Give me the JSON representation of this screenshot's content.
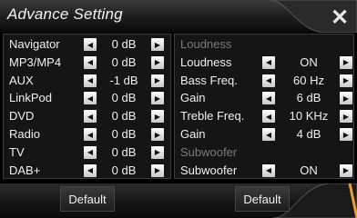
{
  "header": {
    "title": "Advance Setting",
    "close_icon": "close-icon"
  },
  "left_rows": [
    {
      "label": "Navigator",
      "value": "0 dB"
    },
    {
      "label": "MP3/MP4",
      "value": "0 dB"
    },
    {
      "label": "AUX",
      "value": "-1 dB"
    },
    {
      "label": "LinkPod",
      "value": "0 dB"
    },
    {
      "label": "DVD",
      "value": "0 dB"
    },
    {
      "label": "Radio",
      "value": "0 dB"
    },
    {
      "label": "TV",
      "value": "0 dB"
    },
    {
      "label": "DAB+",
      "value": "0 dB"
    }
  ],
  "right_rows": [
    {
      "label": "Loudness",
      "header": true
    },
    {
      "label": "Loudness",
      "value": "ON"
    },
    {
      "label": "Bass Freq.",
      "value": "60 Hz"
    },
    {
      "label": "Gain",
      "value": "6 dB"
    },
    {
      "label": "Treble Freq.",
      "value": "10 KHz"
    },
    {
      "label": "Gain",
      "value": "4 dB"
    },
    {
      "label": "Subwoofer",
      "header": true
    },
    {
      "label": "Subwoofer",
      "value": "ON"
    }
  ],
  "footer": {
    "left_default": "Default",
    "right_default": "Default"
  },
  "colors": {
    "accent_pointer": "#f0a020"
  }
}
